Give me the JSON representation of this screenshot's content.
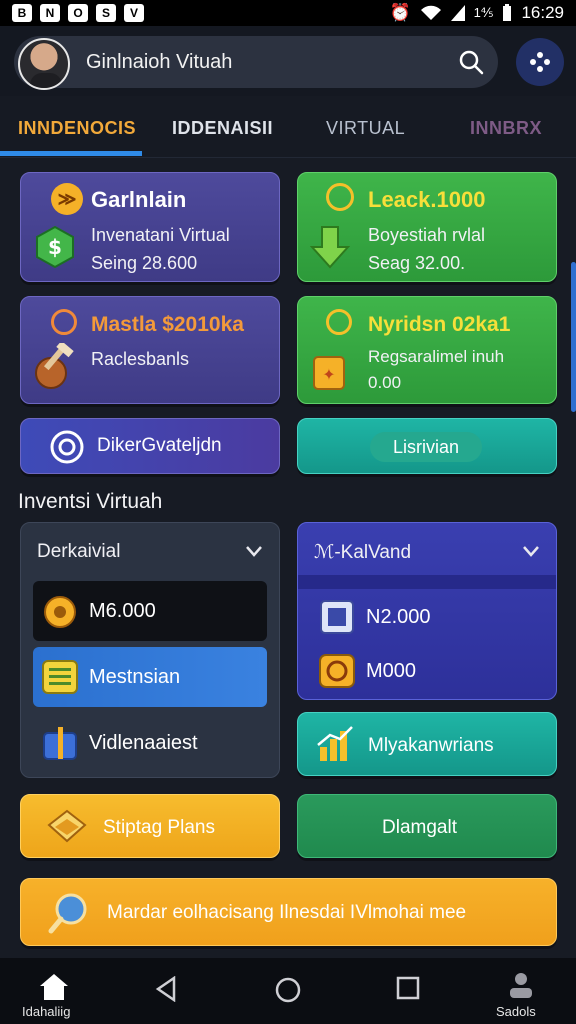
{
  "status_bar": {
    "left_icons": [
      "B",
      "N",
      "O",
      "S",
      "V"
    ],
    "battery": "1⅘",
    "time": "16:29"
  },
  "header": {
    "search_text": "Ginlnaioh Vituah",
    "search_icon": "search-icon",
    "apps_icon": "apps-icon"
  },
  "tabs": [
    {
      "label": "INNDENOCIS",
      "active": true
    },
    {
      "label": "IDDENAISII",
      "active": false
    },
    {
      "label": "VIRTUAL",
      "active": false
    },
    {
      "label": "INNBRX",
      "active": false
    }
  ],
  "cards": {
    "card1": {
      "title": "Garlnlain",
      "line1": "Invenatani Virtual",
      "line2": "Seing 28.600",
      "icon": "dollar-icon"
    },
    "card2": {
      "title": "Leack.1000",
      "line1": "Boyestiah rvlal",
      "line2": "Seag 32.00.",
      "icon": "arrow-down-icon"
    },
    "card3": {
      "title": "Mastla $2010ka",
      "line1": "Raclesbanls",
      "icon": "pickaxe-icon"
    },
    "card4": {
      "title": "Nyridsn 02ka1",
      "line1": "Regsaralimel inuh",
      "line2": "0.00",
      "icon": "badge-icon"
    },
    "card5": {
      "label": "DikerGvateljdn",
      "icon": "refresh-icon"
    },
    "card6": {
      "label": "Lisrivian"
    }
  },
  "section": {
    "title": "Inventsi Virtuah"
  },
  "panel_left": {
    "header": "Derkaivial",
    "rows": [
      {
        "label": "M6.000",
        "icon": "gear-icon"
      },
      {
        "label": "Mestnsian",
        "icon": "list-icon"
      },
      {
        "label": "Vidlenaaiest",
        "icon": "gift-icon"
      }
    ]
  },
  "panel_right": {
    "header": "ℳ-KalVand",
    "rows": [
      {
        "label": "N2.000",
        "icon": "wallet-icon"
      },
      {
        "label": "M000",
        "icon": "coin-icon"
      }
    ]
  },
  "bottom_cards": {
    "right_card": {
      "label": "Mlyakanwrians",
      "icon": "chart-icon"
    },
    "orange": {
      "label": "Stiptag Plans",
      "icon": "book-icon"
    },
    "green": {
      "label": "Dlamgalt"
    },
    "banner": {
      "label": "Mardar eolhacisang Ilnesdai IVlmohai mee",
      "icon": "magnifier-icon"
    }
  },
  "bottom_nav": {
    "home_label": "Idahaliig",
    "social_label": "Sadols"
  },
  "colors": {
    "accent_blue": "#2f8be8",
    "tab_active": "#f2a93a",
    "purple_card": "#4e4a9c",
    "green_card": "#3fb54a",
    "teal_card": "#1fb5a5",
    "orange": "#f5b128"
  }
}
